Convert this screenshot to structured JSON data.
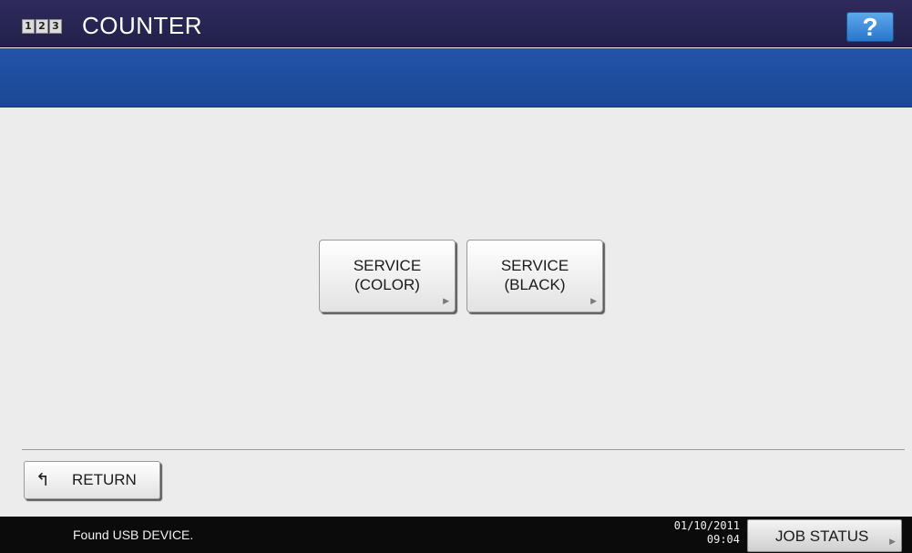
{
  "header": {
    "counter_icon_digits": [
      "1",
      "2",
      "3"
    ],
    "title": "COUNTER",
    "help_label": "?"
  },
  "main": {
    "buttons": [
      {
        "line1": "SERVICE",
        "line2": "(COLOR)",
        "arrow": "▶"
      },
      {
        "line1": "SERVICE",
        "line2": "(BLACK)",
        "arrow": "▶"
      }
    ]
  },
  "footer": {
    "return_icon": "up-arrow-icon",
    "return_label": "RETURN"
  },
  "statusbar": {
    "message": "Found USB DEVICE.",
    "date": "01/10/2011",
    "time": "09:04",
    "job_status_label": "JOB STATUS",
    "job_status_arrow": "▶"
  },
  "colors": {
    "title_bar": "#2e2b5c",
    "blue_band": "#2254a8",
    "help_button": "#3a8be0",
    "background": "#ececec",
    "status_bar": "#0b0b0b"
  }
}
